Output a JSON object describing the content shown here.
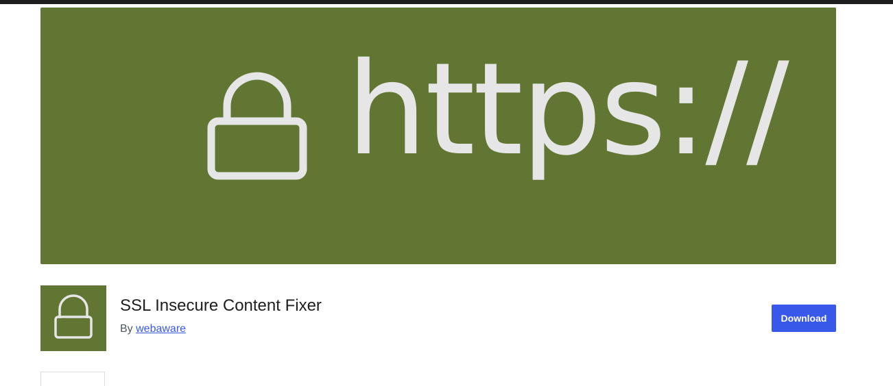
{
  "banner": {
    "text": "https://",
    "background_color": "#617632",
    "text_color": "#e6e6e6",
    "icon": "lock-icon"
  },
  "plugin": {
    "icon": "lock-icon",
    "icon_background": "#617632",
    "title": "SSL Insecure Content Fixer",
    "byline_prefix": "By",
    "author": "webaware"
  },
  "actions": {
    "download_label": "Download",
    "download_color": "#3858e9"
  }
}
